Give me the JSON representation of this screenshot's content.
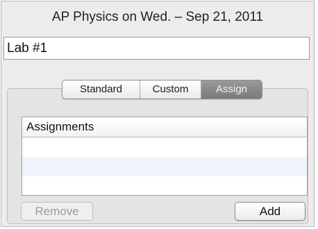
{
  "window": {
    "title": "AP Physics on Wed. – Sep 21, 2011"
  },
  "name_field": {
    "value": "Lab #1"
  },
  "tabs": [
    {
      "label": "Standard",
      "selected": false
    },
    {
      "label": "Custom",
      "selected": false
    },
    {
      "label": "Assign",
      "selected": true
    }
  ],
  "assignments_table": {
    "header": "Assignments",
    "rows": []
  },
  "buttons": {
    "remove_label": "Remove",
    "remove_enabled": false,
    "add_label": "Add"
  },
  "colors": {
    "selected_tab": "#7f7f7f",
    "panel_bg": "#ececec",
    "row_alt": "#f0f4fa"
  }
}
